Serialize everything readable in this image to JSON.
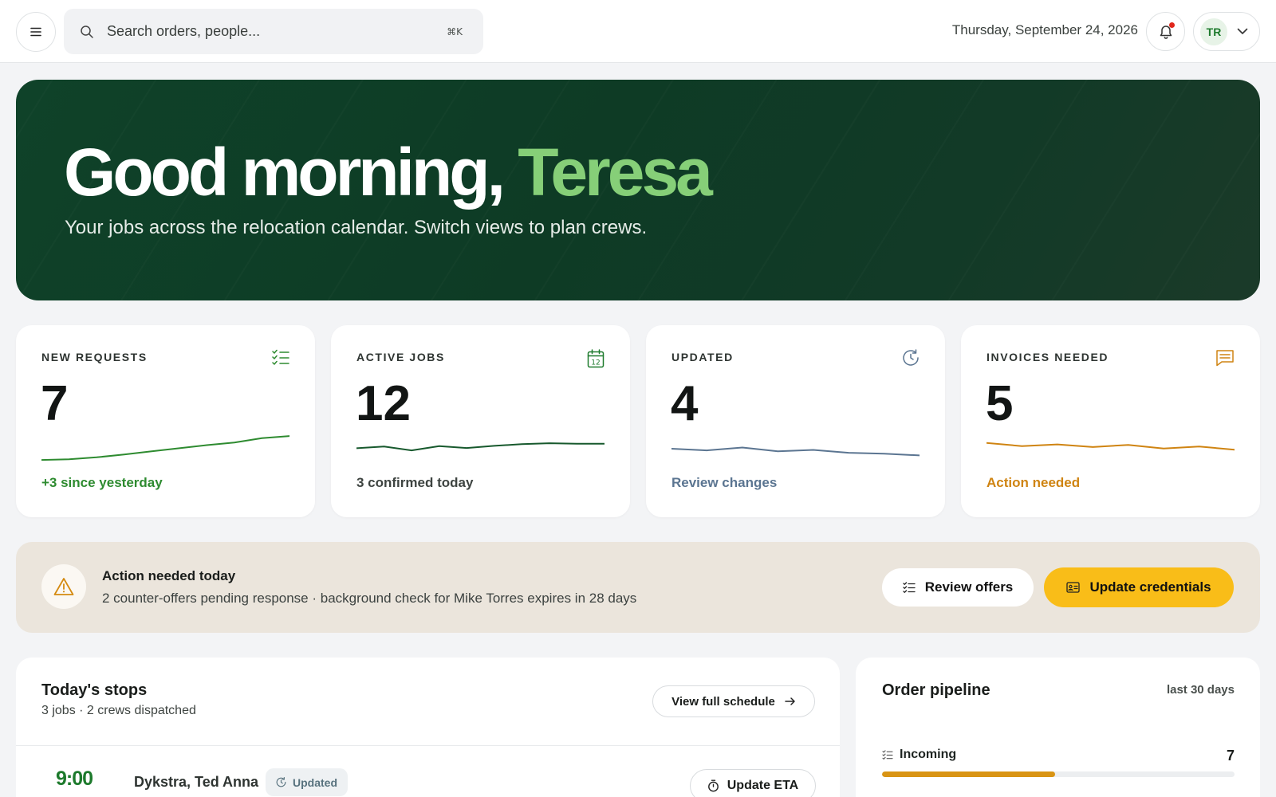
{
  "topbar": {
    "search_placeholder": "Search orders, people...",
    "search_shortcut": "⌘K",
    "date": "Thursday, September 24, 2026",
    "user_initials": "TR",
    "has_notification": true
  },
  "hero": {
    "greeting": "Good morning, ",
    "name": "Teresa",
    "subtitle": "Your jobs across the relocation calendar. Switch views to plan crews."
  },
  "stats": [
    {
      "label": "NEW REQUESTS",
      "value": "7",
      "footer": "+3 since yesterday",
      "icon": "checklist-icon",
      "color": "#2e8b30",
      "trend": [
        0.3,
        0.6,
        1.4,
        2.6,
        3.9,
        5.2,
        6.5,
        7.6,
        9.4,
        10.3
      ]
    },
    {
      "label": "ACTIVE JOBS",
      "value": "12",
      "footer": "3 confirmed today",
      "icon": "calendar-icon",
      "color": "#17592d",
      "trend": [
        5.2,
        5.9,
        4.3,
        6.1,
        5.3,
        6.2,
        6.9,
        7.3,
        7.1,
        7.1
      ]
    },
    {
      "label": "UPDATED",
      "value": "4",
      "footer": "Review changes",
      "icon": "history-icon",
      "color": "#5b7591",
      "trend": [
        5.0,
        4.3,
        5.5,
        3.9,
        4.5,
        3.3,
        2.9,
        2.2
      ]
    },
    {
      "label": "INVOICES NEEDED",
      "value": "5",
      "footer": "Action needed",
      "icon": "message-square-icon",
      "color": "#cf8412",
      "trend": [
        7.4,
        6.1,
        6.8,
        5.7,
        6.6,
        5.1,
        5.9,
        4.6
      ]
    }
  ],
  "alert": {
    "title": "Action needed today",
    "description": "2 counter-offers pending response · background check for Mike Torres expires in 28 days",
    "review_label": "Review offers",
    "credentials_label": "Update credentials"
  },
  "stops": {
    "title": "Today's stops",
    "meta": "3 jobs · 2 crews dispatched",
    "schedule_label": "View full schedule",
    "items": [
      {
        "time": "9:00",
        "name": "Dykstra, Ted Anna",
        "badge": "Updated",
        "action": "Update ETA"
      }
    ]
  },
  "pipeline": {
    "title": "Order pipeline",
    "range": "last 30 days",
    "rows": [
      {
        "label": "Incoming",
        "count": "7",
        "fraction": 0.49
      }
    ]
  },
  "colors": {
    "brand_dark": "#0f4229",
    "accent_green": "#86cf78",
    "warning_yellow": "#f9bd18"
  }
}
